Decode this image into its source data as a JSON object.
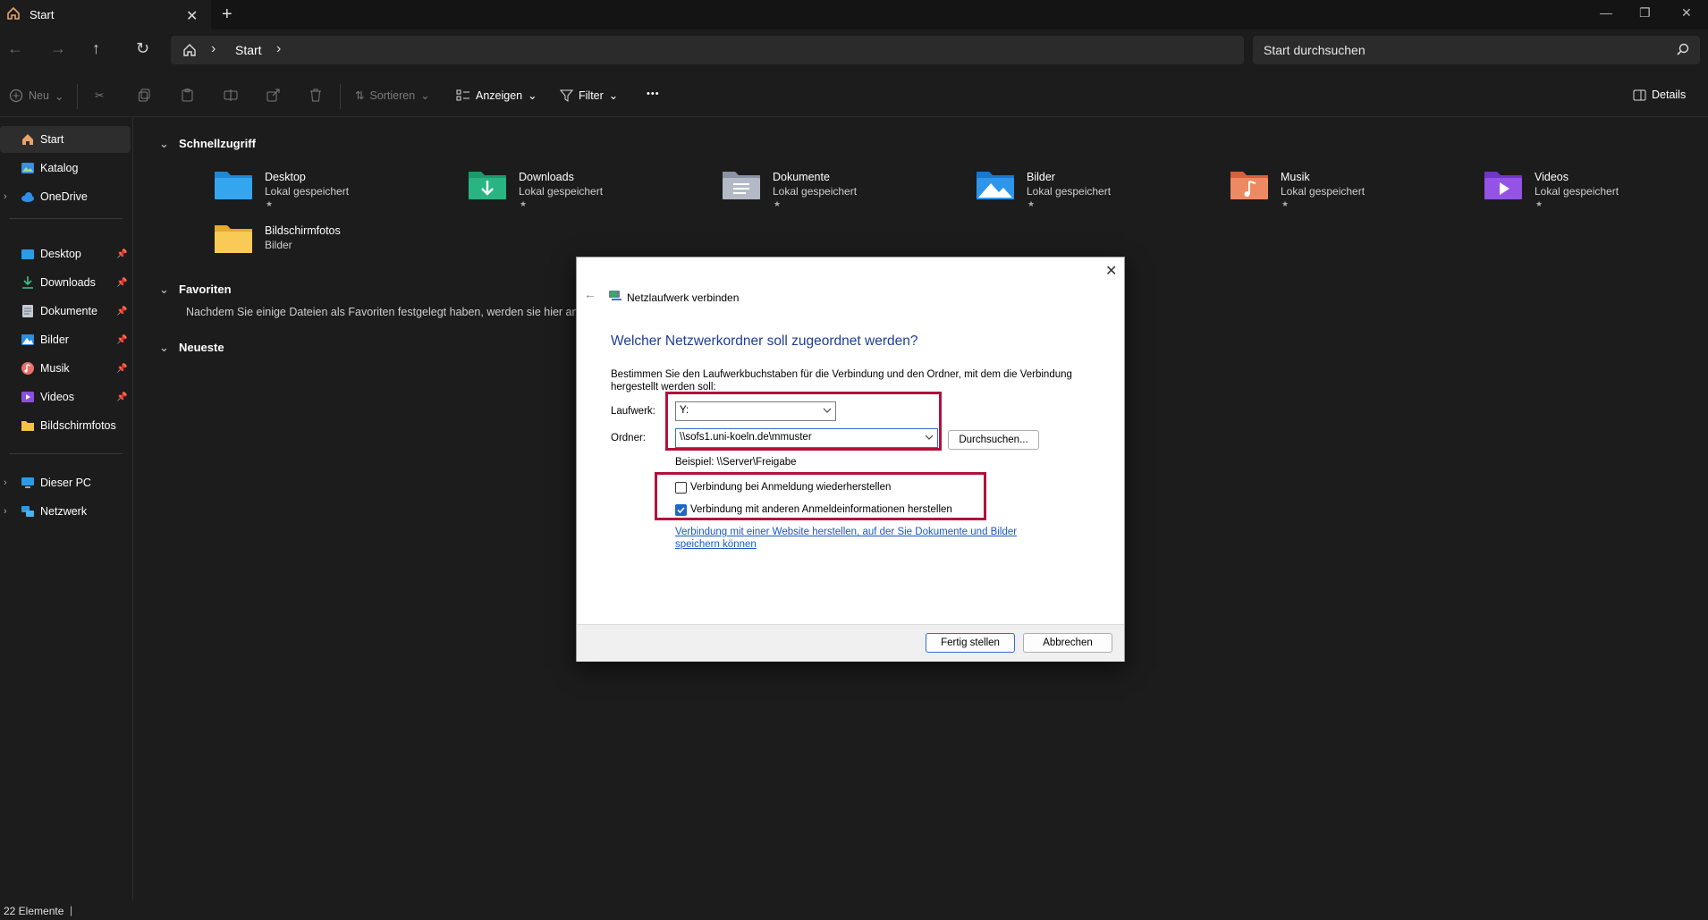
{
  "tab": {
    "title": "Start",
    "close": "✕",
    "new": "+"
  },
  "address": {
    "crumb": "Start"
  },
  "search": {
    "placeholder": "Start durchsuchen"
  },
  "toolbar": {
    "new_label": "Neu",
    "sort_label": "Sortieren",
    "view_label": "Anzeigen",
    "filter_label": "Filter",
    "more_label": "•••",
    "details_label": "Details"
  },
  "sidebar": {
    "items": [
      {
        "label": "Start"
      },
      {
        "label": "Katalog"
      },
      {
        "label": "OneDrive"
      },
      {
        "label": "Desktop"
      },
      {
        "label": "Downloads"
      },
      {
        "label": "Dokumente"
      },
      {
        "label": "Bilder"
      },
      {
        "label": "Musik"
      },
      {
        "label": "Videos"
      },
      {
        "label": "Bildschirmfotos"
      },
      {
        "label": "Dieser PC"
      },
      {
        "label": "Netzwerk"
      }
    ]
  },
  "main": {
    "quick_access_title": "Schnellzugriff",
    "favorites_title": "Favoriten",
    "favorites_text": "Nachdem Sie einige Dateien als Favoriten festgelegt haben, werden sie hier angezeigt.",
    "recent_title": "Neueste",
    "folders": [
      {
        "name": "Desktop",
        "sub": "Lokal gespeichert"
      },
      {
        "name": "Downloads",
        "sub": "Lokal gespeichert"
      },
      {
        "name": "Dokumente",
        "sub": "Lokal gespeichert"
      },
      {
        "name": "Bilder",
        "sub": "Lokal gespeichert"
      },
      {
        "name": "Musik",
        "sub": "Lokal gespeichert"
      },
      {
        "name": "Videos",
        "sub": "Lokal gespeichert"
      },
      {
        "name": "Bildschirmfotos",
        "sub": "Bilder"
      }
    ]
  },
  "status": {
    "count": "22 Elemente"
  },
  "dialog": {
    "window_title": "Netzlaufwerk verbinden",
    "heading": "Welcher Netzwerkordner soll zugeordnet werden?",
    "description": "Bestimmen Sie den Laufwerkbuchstaben für die Verbindung und den Ordner, mit dem die Verbindung hergestellt werden soll:",
    "drive_label": "Laufwerk:",
    "drive_value": "Y:",
    "folder_label": "Ordner:",
    "folder_value": "\\\\sofs1.uni-koeln.de\\mmuster",
    "browse_label": "Durchsuchen...",
    "example": "Beispiel: \\\\Server\\Freigabe",
    "reconnect_label": "Verbindung bei Anmeldung wiederherstellen",
    "reconnect_checked": false,
    "other_creds_label": "Verbindung mit anderen Anmeldeinformationen herstellen",
    "other_creds_checked": true,
    "website_link": "Verbindung mit einer Website herstellen, auf der Sie Dokumente und Bilder speichern können",
    "finish_label": "Fertig stellen",
    "cancel_label": "Abbrechen"
  },
  "colors": {
    "highlight_box": "#b0123c",
    "dialog_heading": "#1e3d99",
    "link": "#1a57c9"
  }
}
